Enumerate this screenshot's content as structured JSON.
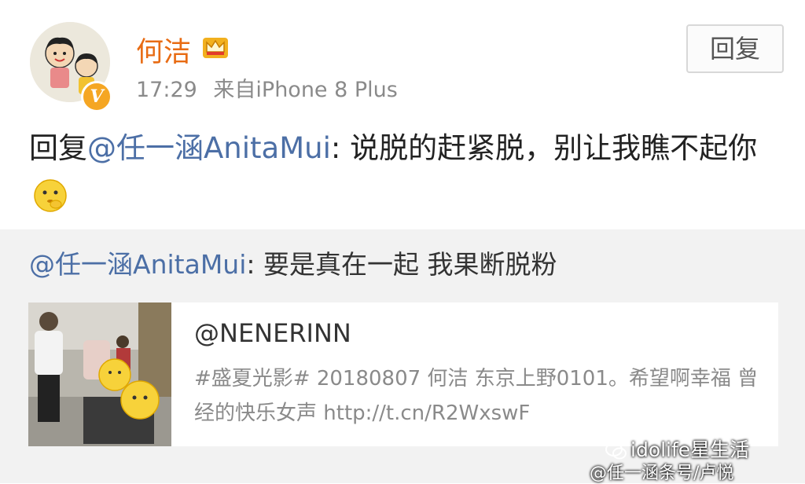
{
  "post": {
    "username": "何洁",
    "time": "17:29",
    "source": "来自iPhone 8 Plus",
    "reply_button": "回复",
    "text_prefix": "回复",
    "mention": "@任一涵AnitaMui",
    "text_body": ": 说脱的赶紧脱，别让我瞧不起你",
    "badge_letter": "V"
  },
  "repost": {
    "mention": "@任一涵AnitaMui",
    "text": ": 要是真在一起 我果断脱粉",
    "card": {
      "title": "@NENERINN",
      "description": "#盛夏光影# 20180807  何洁 东京上野0101。希望啊幸福 曾经的快乐女声 http://t.cn/R2WxswF"
    }
  },
  "watermark": {
    "line1": "idolife星生活",
    "line2": "@任一涵条号/卢悦"
  },
  "colors": {
    "username": "#e86b13",
    "mention": "#4c6fa6",
    "repost_bg": "#f2f2f2",
    "badge": "#f5a623"
  }
}
